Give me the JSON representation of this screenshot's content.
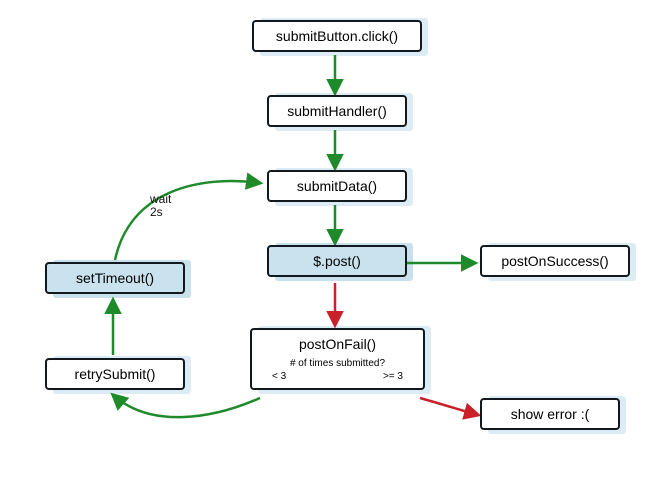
{
  "chart_data": {
    "type": "flowchart",
    "title": "",
    "nodes": [
      {
        "id": "click",
        "label": "submitButton.click()",
        "fill": "white"
      },
      {
        "id": "handler",
        "label": "submitHandler()",
        "fill": "white"
      },
      {
        "id": "data",
        "label": "submitData()",
        "fill": "white"
      },
      {
        "id": "post",
        "label": "$.post()",
        "fill": "blue"
      },
      {
        "id": "success",
        "label": "postOnSuccess()",
        "fill": "white"
      },
      {
        "id": "fail",
        "label": "postOnFail()",
        "fill": "white",
        "subtext": "# of times submitted?",
        "branches": {
          "left": "< 3",
          "right": ">= 3"
        }
      },
      {
        "id": "error",
        "label": "show error :(",
        "fill": "white"
      },
      {
        "id": "retry",
        "label": "retrySubmit()",
        "fill": "white"
      },
      {
        "id": "timeout",
        "label": "setTimeout()",
        "fill": "blue"
      }
    ],
    "edges": [
      {
        "from": "click",
        "to": "handler",
        "color": "green"
      },
      {
        "from": "handler",
        "to": "data",
        "color": "green"
      },
      {
        "from": "data",
        "to": "post",
        "color": "green"
      },
      {
        "from": "post",
        "to": "success",
        "color": "green"
      },
      {
        "from": "post",
        "to": "fail",
        "color": "red"
      },
      {
        "from": "fail",
        "to": "error",
        "color": "red",
        "branch": ">= 3"
      },
      {
        "from": "fail",
        "to": "retry",
        "color": "green",
        "branch": "< 3"
      },
      {
        "from": "retry",
        "to": "timeout",
        "color": "green"
      },
      {
        "from": "timeout",
        "to": "data",
        "color": "green",
        "label": "wait\n2s"
      }
    ]
  },
  "labels": {
    "wait": "wait",
    "wait2": "2s"
  }
}
